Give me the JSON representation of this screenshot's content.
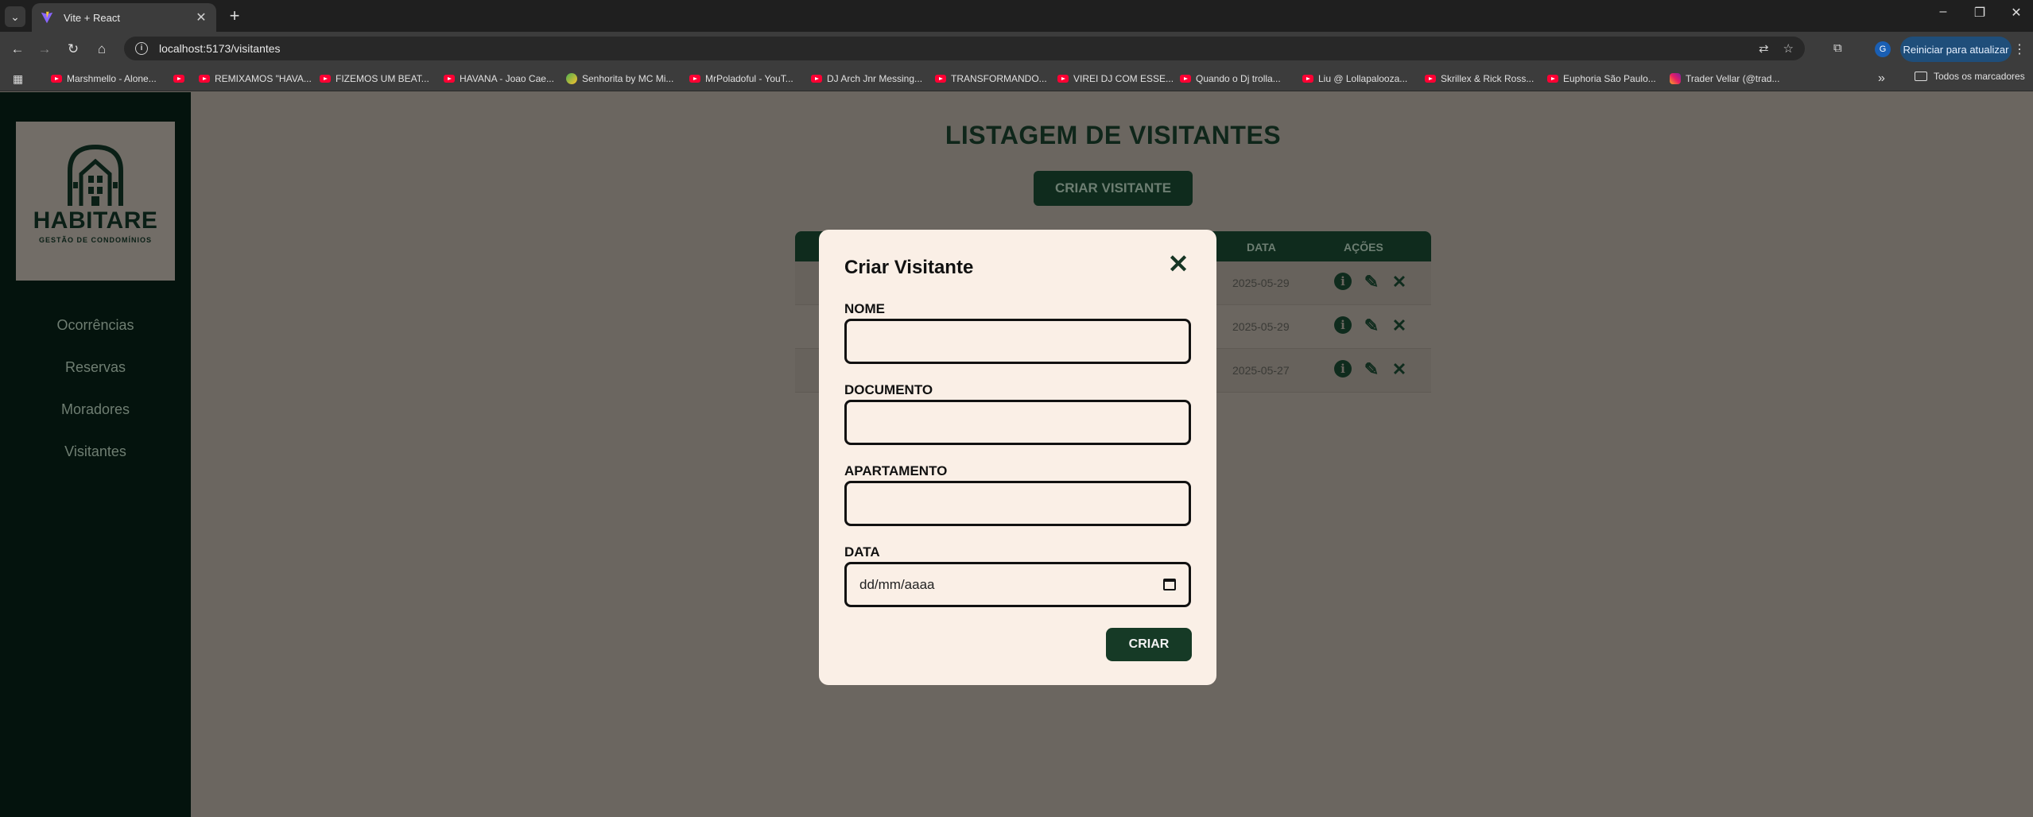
{
  "browser": {
    "tab_title": "Vite + React",
    "url": "localhost:5173/visitantes",
    "update_label": "Reiniciar para atualizar",
    "profile_initial": "G",
    "bookmarks": [
      {
        "label": "Marshmello - Alone...",
        "icon": "youtube"
      },
      {
        "label": "",
        "icon": "youtube"
      },
      {
        "label": "REMIXAMOS \"HAVA...",
        "icon": "youtube"
      },
      {
        "label": "FIZEMOS UM BEAT...",
        "icon": "youtube"
      },
      {
        "label": "HAVANA - Joao Cae...",
        "icon": "youtube"
      },
      {
        "label": "Senhorita by MC Mi...",
        "icon": "globe"
      },
      {
        "label": "MrPoladoful - YouT...",
        "icon": "youtube"
      },
      {
        "label": "DJ Arch Jnr Messing...",
        "icon": "youtube"
      },
      {
        "label": "TRANSFORMANDO...",
        "icon": "youtube"
      },
      {
        "label": "VIREI DJ COM ESSE...",
        "icon": "youtube"
      },
      {
        "label": "Quando o Dj trolla...",
        "icon": "youtube"
      },
      {
        "label": "Liu @ Lollapalooza...",
        "icon": "youtube"
      },
      {
        "label": "Skrillex & Rick Ross...",
        "icon": "youtube"
      },
      {
        "label": "Euphoria São Paulo...",
        "icon": "youtube"
      },
      {
        "label": "Trader Vellar (@trad...",
        "icon": "instagram"
      }
    ],
    "bookmarks_folder": "Todos os marcadores"
  },
  "sidebar": {
    "logo": {
      "name": "HABITARE",
      "tagline": "GESTÃO DE CONDOMÍNIOS"
    },
    "items": [
      {
        "label": "Ocorrências"
      },
      {
        "label": "Reservas"
      },
      {
        "label": "Moradores"
      },
      {
        "label": "Visitantes"
      }
    ]
  },
  "main": {
    "title": "LISTAGEM DE VISITANTES",
    "create_button": "CRIAR VISITANTE",
    "table": {
      "headers": {
        "date": "DATA",
        "actions": "AÇÕES"
      },
      "rows": [
        {
          "date": "2025-05-29"
        },
        {
          "date": "2025-05-29"
        },
        {
          "date": "2025-05-27"
        }
      ]
    }
  },
  "modal": {
    "title": "Criar Visitante",
    "fields": {
      "nome": {
        "label": "NOME",
        "value": ""
      },
      "documento": {
        "label": "DOCUMENTO",
        "value": ""
      },
      "apartamento": {
        "label": "APARTAMENTO",
        "value": ""
      },
      "data": {
        "label": "DATA",
        "placeholder": "dd/mm/aaaa"
      }
    },
    "submit": "CRIAR"
  },
  "colors": {
    "sidebar_bg": "#04130d",
    "accent_green": "#163a26",
    "modal_bg": "#faefe6",
    "overlay": "#6b6660"
  }
}
